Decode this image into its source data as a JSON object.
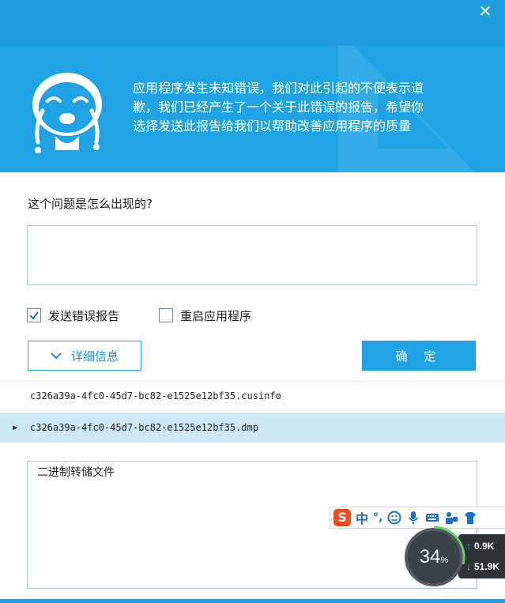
{
  "window": {
    "close_icon": "close-icon"
  },
  "banner": {
    "message_lines": [
      "应用程序发生未知错误，我们对此引起的不便表示道",
      "歉，我们已经产生了一个关于此错误的报告，希望你",
      "选择发送此报告给我们以帮助改善应用程序的质量"
    ],
    "mascot_icon": "crying-face-icon"
  },
  "form": {
    "question_label": "这个问题是怎么出现的?",
    "description_value": "",
    "send_report": {
      "label": "发送错误报告",
      "checked": true
    },
    "restart_app": {
      "label": "重启应用程序",
      "checked": false
    },
    "detail_button": "详细信息",
    "ok_button": "确 定"
  },
  "files": [
    {
      "name": "c326a39a-4fc0-45d7-bc82-e1525e12bf35.cusinfo",
      "selected": false
    },
    {
      "name": "c326a39a-4fc0-45d7-bc82-e1525e12bf35.dmp",
      "selected": true
    }
  ],
  "file_content": "二进制转储文件",
  "ime_toolbar": {
    "logo": "S",
    "mode": "中",
    "punct": "°,",
    "icons": [
      "emoji-icon",
      "microphone-icon",
      "keyboard-icon",
      "toolbox-icon",
      "skin-icon"
    ]
  },
  "speed_widget": {
    "percent": "34",
    "percent_unit": "%",
    "upload": "0.9K",
    "download": "51.9K"
  },
  "colors": {
    "brand_blue": "#1fa3e4",
    "selected_row": "#cfe8f6",
    "ime_red": "#f24a1d"
  }
}
